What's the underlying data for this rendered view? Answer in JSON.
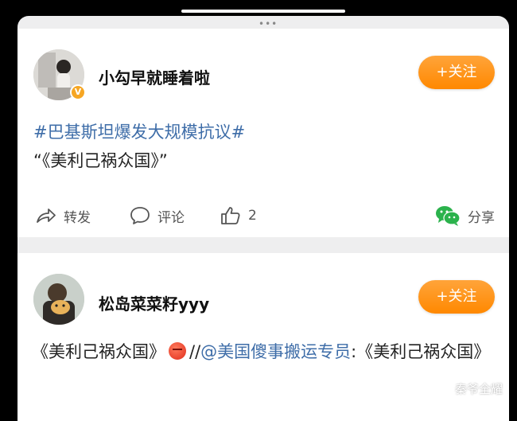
{
  "posts": [
    {
      "username": "小勾早就睡着啦",
      "follow_label": "+关注",
      "topic": "#巴基斯坦爆发大规模抗议#",
      "text": "“《美利己祸众国》”",
      "actions": {
        "forward": "转发",
        "comment": "评论",
        "like_count": "2",
        "share": "分享"
      },
      "verified_badge": "V"
    },
    {
      "username": "松岛菜菜籽yyy",
      "follow_label": "+关注",
      "text_before": "《美利己祸众国》",
      "separator": "//",
      "mention": "@美国傻事搬运专员",
      "text_after": ":《美利己祸众国》"
    }
  ],
  "watermark": "秦爷全耀",
  "colors": {
    "follow_button": "#ff9419",
    "link_blue": "#3e6da8",
    "wechat_green": "#2bb24c"
  },
  "icons": [
    "forward-icon",
    "comment-icon",
    "like-icon",
    "wechat-icon"
  ]
}
